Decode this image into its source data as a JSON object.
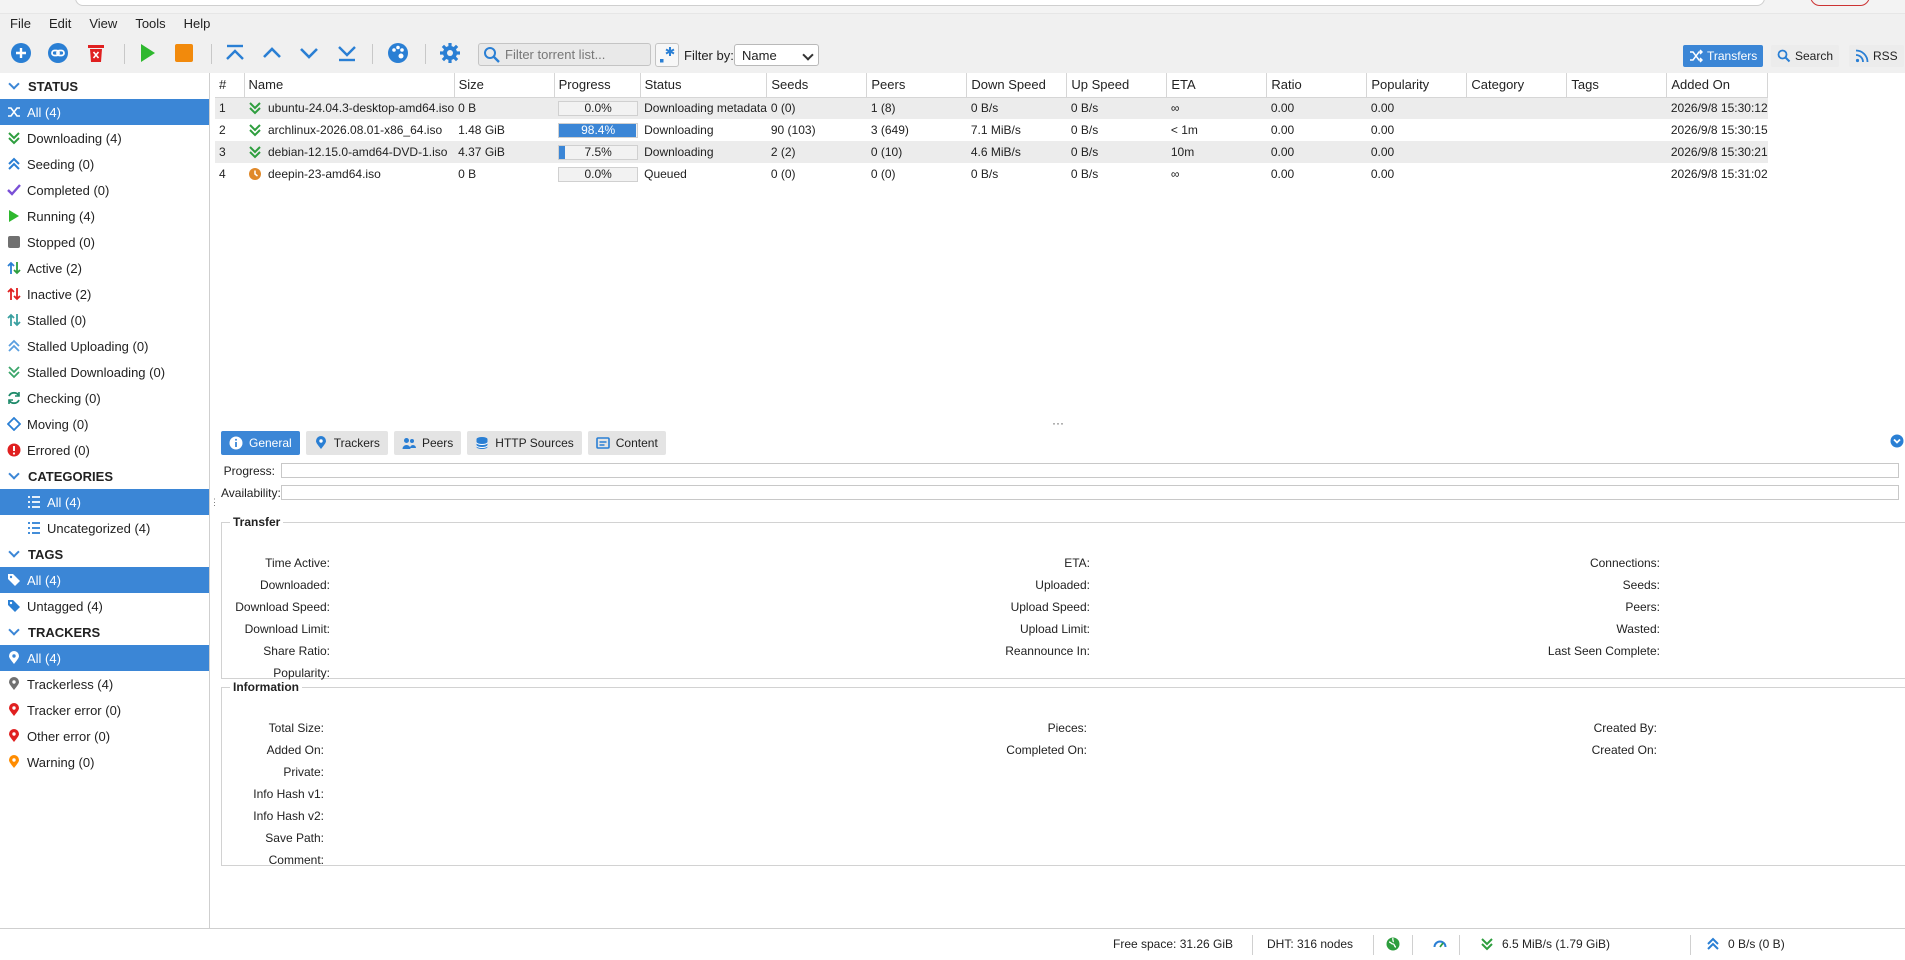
{
  "menu": [
    "File",
    "Edit",
    "View",
    "Tools",
    "Help"
  ],
  "toolbar": {
    "filter_placeholder": "Filter torrent list...",
    "filter_by_label": "Filter by:",
    "filter_by_value": "Name",
    "views": [
      "Transfers",
      "Search",
      "RSS"
    ]
  },
  "sidebar": {
    "status_title": "STATUS",
    "status_items": [
      "All (4)",
      "Downloading (4)",
      "Seeding (0)",
      "Completed (0)",
      "Running (4)",
      "Stopped (0)",
      "Active (2)",
      "Inactive (2)",
      "Stalled (0)",
      "Stalled Uploading (0)",
      "Stalled Downloading (0)",
      "Checking (0)",
      "Moving (0)",
      "Errored (0)"
    ],
    "categories_title": "CATEGORIES",
    "category_items": [
      "All (4)",
      "Uncategorized (4)"
    ],
    "tags_title": "TAGS",
    "tag_items": [
      "All (4)",
      "Untagged (4)"
    ],
    "trackers_title": "TRACKERS",
    "tracker_items": [
      "All (4)",
      "Trackerless (4)",
      "Tracker error (0)",
      "Other error (0)",
      "Warning (0)"
    ]
  },
  "table": {
    "columns": [
      "#",
      "Name",
      "Size",
      "Progress",
      "Status",
      "Seeds",
      "Peers",
      "Down Speed",
      "Up Speed",
      "ETA",
      "Ratio",
      "Popularity",
      "Category",
      "Tags",
      "Added On"
    ],
    "rows": [
      {
        "num": "1",
        "name": "ubuntu-24.04.3-desktop-amd64.iso",
        "size": "0 B",
        "progress": 0.0,
        "progress_label": "0.0%",
        "status": "Downloading metadata",
        "seeds": "0 (0)",
        "peers": "1 (8)",
        "down": "0 B/s",
        "up": "0 B/s",
        "eta": "∞",
        "ratio": "0.00",
        "popularity": "0.00",
        "category": "",
        "tags": "",
        "added": "2026/9/8 15:30:12",
        "icon": "downloading-icon"
      },
      {
        "num": "2",
        "name": "archlinux-2026.08.01-x86_64.iso",
        "size": "1.48 GiB",
        "progress": 98.4,
        "progress_label": "98.4%",
        "status": "Downloading",
        "seeds": "90 (103)",
        "peers": "3 (649)",
        "down": "7.1 MiB/s",
        "up": "0 B/s",
        "eta": "< 1m",
        "ratio": "0.00",
        "popularity": "0.00",
        "category": "",
        "tags": "",
        "added": "2026/9/8 15:30:15",
        "icon": "downloading-icon"
      },
      {
        "num": "3",
        "name": "debian-12.15.0-amd64-DVD-1.iso",
        "size": "4.37 GiB",
        "progress": 7.5,
        "progress_label": "7.5%",
        "status": "Downloading",
        "seeds": "2 (2)",
        "peers": "0 (10)",
        "down": "4.6 MiB/s",
        "up": "0 B/s",
        "eta": "10m",
        "ratio": "0.00",
        "popularity": "0.00",
        "category": "",
        "tags": "",
        "added": "2026/9/8 15:30:21",
        "icon": "downloading-icon"
      },
      {
        "num": "4",
        "name": "deepin-23-amd64.iso",
        "size": "0 B",
        "progress": 0.0,
        "progress_label": "0.0%",
        "status": "Queued",
        "seeds": "0 (0)",
        "peers": "0 (0)",
        "down": "0 B/s",
        "up": "0 B/s",
        "eta": "∞",
        "ratio": "0.00",
        "popularity": "0.00",
        "category": "",
        "tags": "",
        "added": "2026/9/8 15:31:02",
        "icon": "queued-icon"
      }
    ]
  },
  "details": {
    "tabs": [
      "General",
      "Trackers",
      "Peers",
      "HTTP Sources",
      "Content"
    ],
    "progress_label": "Progress:",
    "availability_label": "Availability:",
    "transfer_title": "Transfer",
    "transfer_col1": [
      "Time Active:",
      "Downloaded:",
      "Download Speed:",
      "Download Limit:",
      "Share Ratio:",
      "Popularity:"
    ],
    "transfer_col2": [
      "ETA:",
      "Uploaded:",
      "Upload Speed:",
      "Upload Limit:",
      "Reannounce In:"
    ],
    "transfer_col3": [
      "Connections:",
      "Seeds:",
      "Peers:",
      "Wasted:",
      "Last Seen Complete:"
    ],
    "info_title": "Information",
    "info_col1": [
      "Total Size:",
      "Added On:",
      "Private:",
      "Info Hash v1:",
      "Info Hash v2:",
      "Save Path:",
      "Comment:"
    ],
    "info_col2": [
      "Pieces:",
      "Completed On:"
    ],
    "info_col3": [
      "Created By:",
      "Created On:"
    ]
  },
  "statusbar": {
    "free_space": "Free space: 31.26 GiB",
    "dht": "DHT: 316 nodes",
    "down": "6.5 MiB/s (1.79 GiB)",
    "up": "0 B/s (0 B)"
  },
  "colors": {
    "accent": "#3b86d6",
    "download": "#2e9e3e",
    "error": "#e02020",
    "warning": "#ff8c00"
  }
}
